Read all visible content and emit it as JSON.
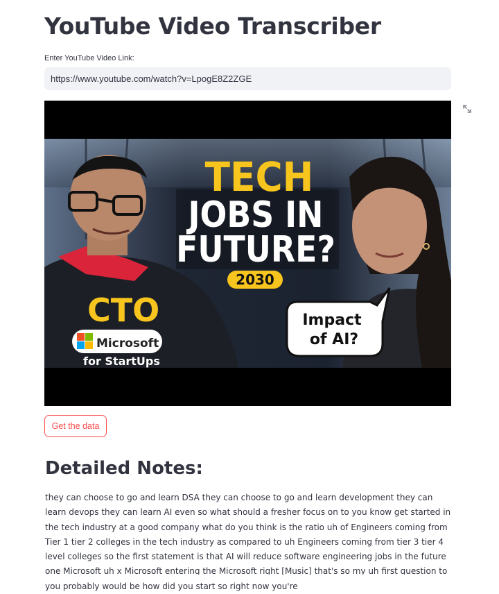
{
  "app": {
    "title": "YouTube Video Transcriber"
  },
  "input": {
    "label": "Enter YouTube Video Link:",
    "value": "https://www.youtube.com/watch?v=LpogE8Z2ZGE"
  },
  "thumbnail": {
    "headline_line1": "TECH",
    "headline_line2": "JOBS IN",
    "headline_line3": "FUTURE?",
    "year_badge": "2030",
    "role_text": "CTO",
    "brand_text": "Microsoft",
    "brand_sub": "for StartUps",
    "bubble_line1": "Impact",
    "bubble_line2": "of AI?"
  },
  "button": {
    "label": "Get the data"
  },
  "notes": {
    "heading": "Detailed Notes:",
    "body": "they can choose to go and learn DSA they can choose to go and learn development they can learn devops they can learn AI even so what should a fresher focus on to you know get started in the tech industry at a good company what do you think is the ratio uh of Engineers coming from Tier 1 tier 2 colleges in the tech industry as compared to uh Engineers coming from tier 3 tier 4 level colleges so the first statement is that AI will reduce software engineering jobs in the future one Microsoft uh x Microsoft entering the Microsoft right [Music] that's so my uh first question to you probably would be how did you start so right now you're"
  },
  "colors": {
    "accent": "#ff4b4b",
    "input_bg": "#f0f2f6",
    "text": "#31333f",
    "headline_yellow": "#f7c51d"
  },
  "icons": [
    "fullscreen-expand-icon",
    "microsoft-logo-icon"
  ]
}
